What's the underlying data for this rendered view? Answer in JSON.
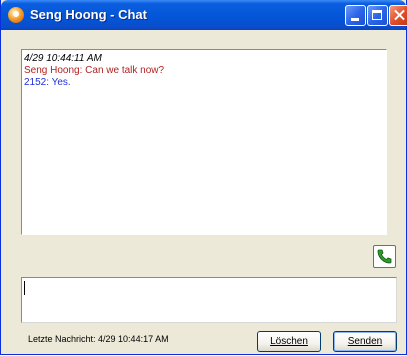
{
  "window": {
    "title": "Seng Hoong - Chat",
    "controls": {
      "minimize": "minimize",
      "maximize": "maximize",
      "close": "close"
    }
  },
  "chat_log": {
    "lines": [
      {
        "text": "4/29 10:44:11 AM",
        "color": "#000000"
      },
      {
        "text": "Seng Hoong: Can we talk now?",
        "color": "#b22222"
      },
      {
        "text": "2152: Yes.",
        "color": "#1f30d8"
      }
    ]
  },
  "call_button": {
    "icon": "phone-icon"
  },
  "message_input": {
    "value": ""
  },
  "status": {
    "text": "Letzte Nachricht: 4/29 10:44:17 AM"
  },
  "buttons": {
    "clear_label": "Löschen",
    "send_label": "Senden"
  },
  "colors": {
    "title_bar": "#0458d8",
    "accent": "#1f30d8",
    "sender": "#b22222"
  }
}
